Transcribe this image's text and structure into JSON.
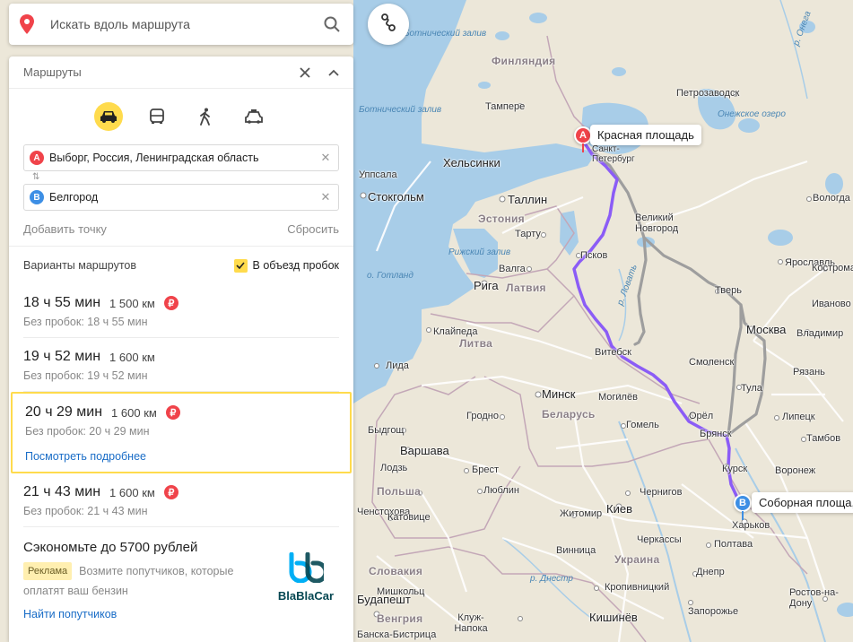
{
  "search": {
    "placeholder": "Искать вдоль маршрута"
  },
  "panel": {
    "title": "Маршруты",
    "point_a": {
      "badge": "A",
      "text": "Выборг, Россия, Ленинградская область"
    },
    "point_b": {
      "badge": "B",
      "text": "Белгород"
    },
    "swap_glyph": "⇅",
    "add_point": "Добавить точку",
    "reset": "Сбросить",
    "variants_title": "Варианты маршрутов",
    "avoid_traffic": "В объезд пробок",
    "avoid_traffic_checked": true,
    "routes": [
      {
        "time": "18 ч 55 мин",
        "distance": "1 500 км",
        "toll": true,
        "no_traffic": "Без пробок: 18 ч 55 мин"
      },
      {
        "time": "19 ч 52 мин",
        "distance": "1 600 км",
        "toll": false,
        "no_traffic": "Без пробок: 19 ч 52 мин"
      },
      {
        "time": "20 ч 29 мин",
        "distance": "1 600 км",
        "toll": true,
        "no_traffic": "Без пробок: 20 ч 29 мин",
        "details_link": "Посмотреть подробнее"
      },
      {
        "time": "21 ч 43 мин",
        "distance": "1 600 км",
        "toll": true,
        "no_traffic": "Без пробок: 21 ч 43 мин"
      }
    ],
    "toll_glyph": "₽",
    "selected_route_index": 2,
    "promo": {
      "title": "Сэкономьте до 5700 рублей",
      "badge": "Реклама",
      "text_1": "Возмите попутчиков, которые",
      "text_2": "оплатят ваш бензин",
      "link": "Найти попутчиков",
      "logo_text": "BlaBlaCar"
    }
  },
  "map": {
    "pin_a_label": "Красная площадь",
    "pin_b_label": "Соборная площа,",
    "countries": [
      "Финляндия",
      "Эстония",
      "Латвия",
      "Литва",
      "Беларусь",
      "Польша",
      "Украина",
      "Словакия",
      "Венгрия"
    ],
    "water": [
      "Ботнический залив",
      "Ботнический залив",
      "Рижский залив",
      "о. Готланд",
      "р. Онега",
      "Онежское озеро",
      "р. Ловать",
      "р. Днестр"
    ],
    "cities": [
      "Тампере",
      "Петрозаводск",
      "Хельсинки",
      "Санкт-Петербург",
      "Уппсала",
      "Стокгольм",
      "Таллин",
      "Тарту",
      "Великий Новгород",
      "Псков",
      "Вологда",
      "Валга",
      "Рига",
      "Тверь",
      "Ярославль",
      "Кострома",
      "Иваново",
      "Москва",
      "Владимир",
      "Клайпеда",
      "Витебск",
      "Смоленск",
      "Тула",
      "Рязань",
      "Минск",
      "Могилёв",
      "Орёл",
      "Брянск",
      "Липецк",
      "Тамбов",
      "Гродно",
      "Гомель",
      "Курск",
      "Воронеж",
      "Быдгощ",
      "Варшава",
      "Лодзь",
      "Брест",
      "Киев",
      "Житомир",
      "Чернигов",
      "Харьков",
      "Ченстохова",
      "Люблин",
      "Катовице",
      "Винница",
      "Черкассы",
      "Полтава",
      "Днепр",
      "Кропивницкий",
      "Запорожье",
      "Мишкольц",
      "Будапешт",
      "Кишинёв",
      "Клуж-Напока",
      "Ростов-на-Дону",
      "Варшава",
      "Банска-Бистрица",
      "Лида"
    ],
    "colors": {
      "route_selected": "#8b5cf6",
      "route_alt": "#9e9e9e",
      "pin_a": "#f0434a",
      "pin_b": "#3d8fe5",
      "accent": "#ffdb4d",
      "link": "#1a6dc7"
    }
  }
}
